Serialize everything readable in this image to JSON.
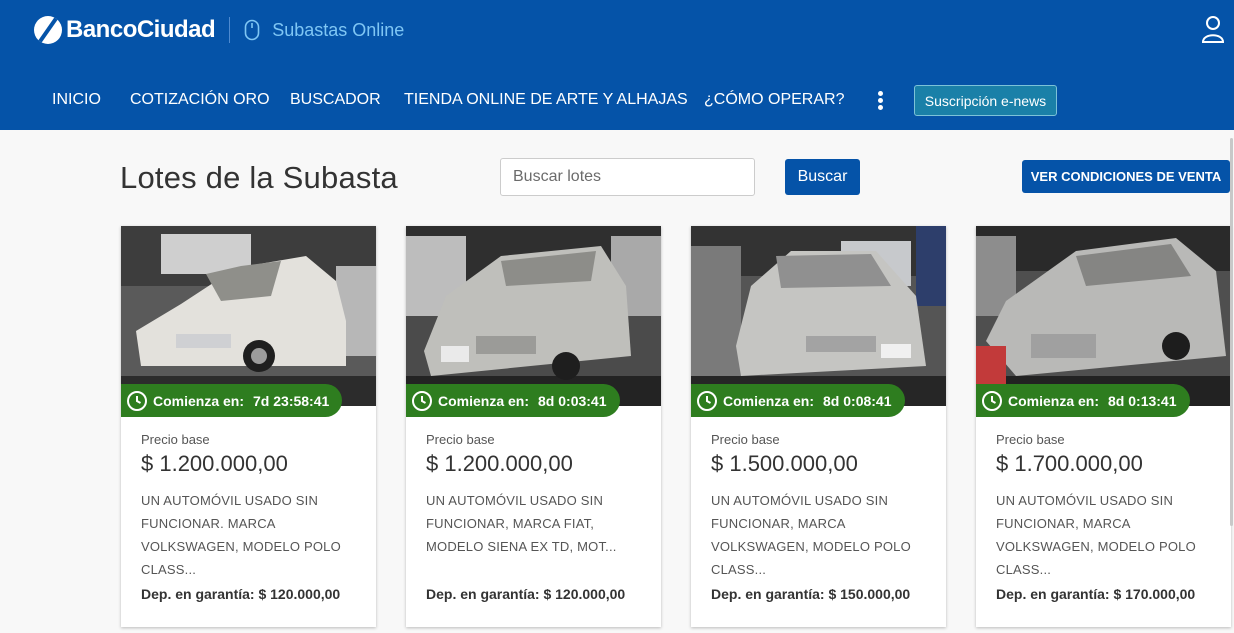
{
  "header": {
    "brand": "BancoCiudad",
    "subtitle": "Subastas Online",
    "color": "#0553a8",
    "nav": [
      "INICIO",
      "COTIZACIÓN ORO",
      "BUSCADOR",
      "TIENDA ONLINE DE ARTE Y ALHAJAS",
      "¿CÓMO OPERAR?"
    ],
    "enews_label": "Suscripción e-news"
  },
  "main": {
    "title": "Lotes de la Subasta",
    "search_placeholder": "Buscar lotes",
    "search_button": "Buscar",
    "conditions_button": "VER CONDICIONES DE VENTA"
  },
  "lots": [
    {
      "timer_label": "Comienza en:",
      "timer_value": "7d 23:58:41",
      "price_label": "Precio base",
      "price": "$ 1.200.000,00",
      "description": "UN AUTOMÓVIL USADO SIN FUNCIONAR. MARCA VOLKSWAGEN, MODELO POLO CLASS...",
      "deposit": "Dep. en garantía: $ 120.000,00",
      "car_color": "white"
    },
    {
      "timer_label": "Comienza en:",
      "timer_value": "8d 0:03:41",
      "price_label": "Precio base",
      "price": "$ 1.200.000,00",
      "description": "UN AUTOMÓVIL USADO SIN FUNCIONAR, MARCA FIAT, MODELO SIENA EX TD, MOT...",
      "deposit": "Dep. en garantía: $ 120.000,00",
      "car_color": "silver"
    },
    {
      "timer_label": "Comienza en:",
      "timer_value": "8d 0:08:41",
      "price_label": "Precio base",
      "price": "$ 1.500.000,00",
      "description": "UN AUTOMÓVIL USADO SIN FUNCIONAR, MARCA VOLKSWAGEN, MODELO POLO CLASS...",
      "deposit": "Dep. en garantía: $ 150.000,00",
      "car_color": "silver"
    },
    {
      "timer_label": "Comienza en:",
      "timer_value": "8d 0:13:41",
      "price_label": "Precio base",
      "price": "$ 1.700.000,00",
      "description": "UN AUTOMÓVIL USADO SIN FUNCIONAR, MARCA VOLKSWAGEN, MODELO POLO CLASS...",
      "deposit": "Dep. en garantía: $ 170.000,00",
      "car_color": "silver"
    }
  ]
}
